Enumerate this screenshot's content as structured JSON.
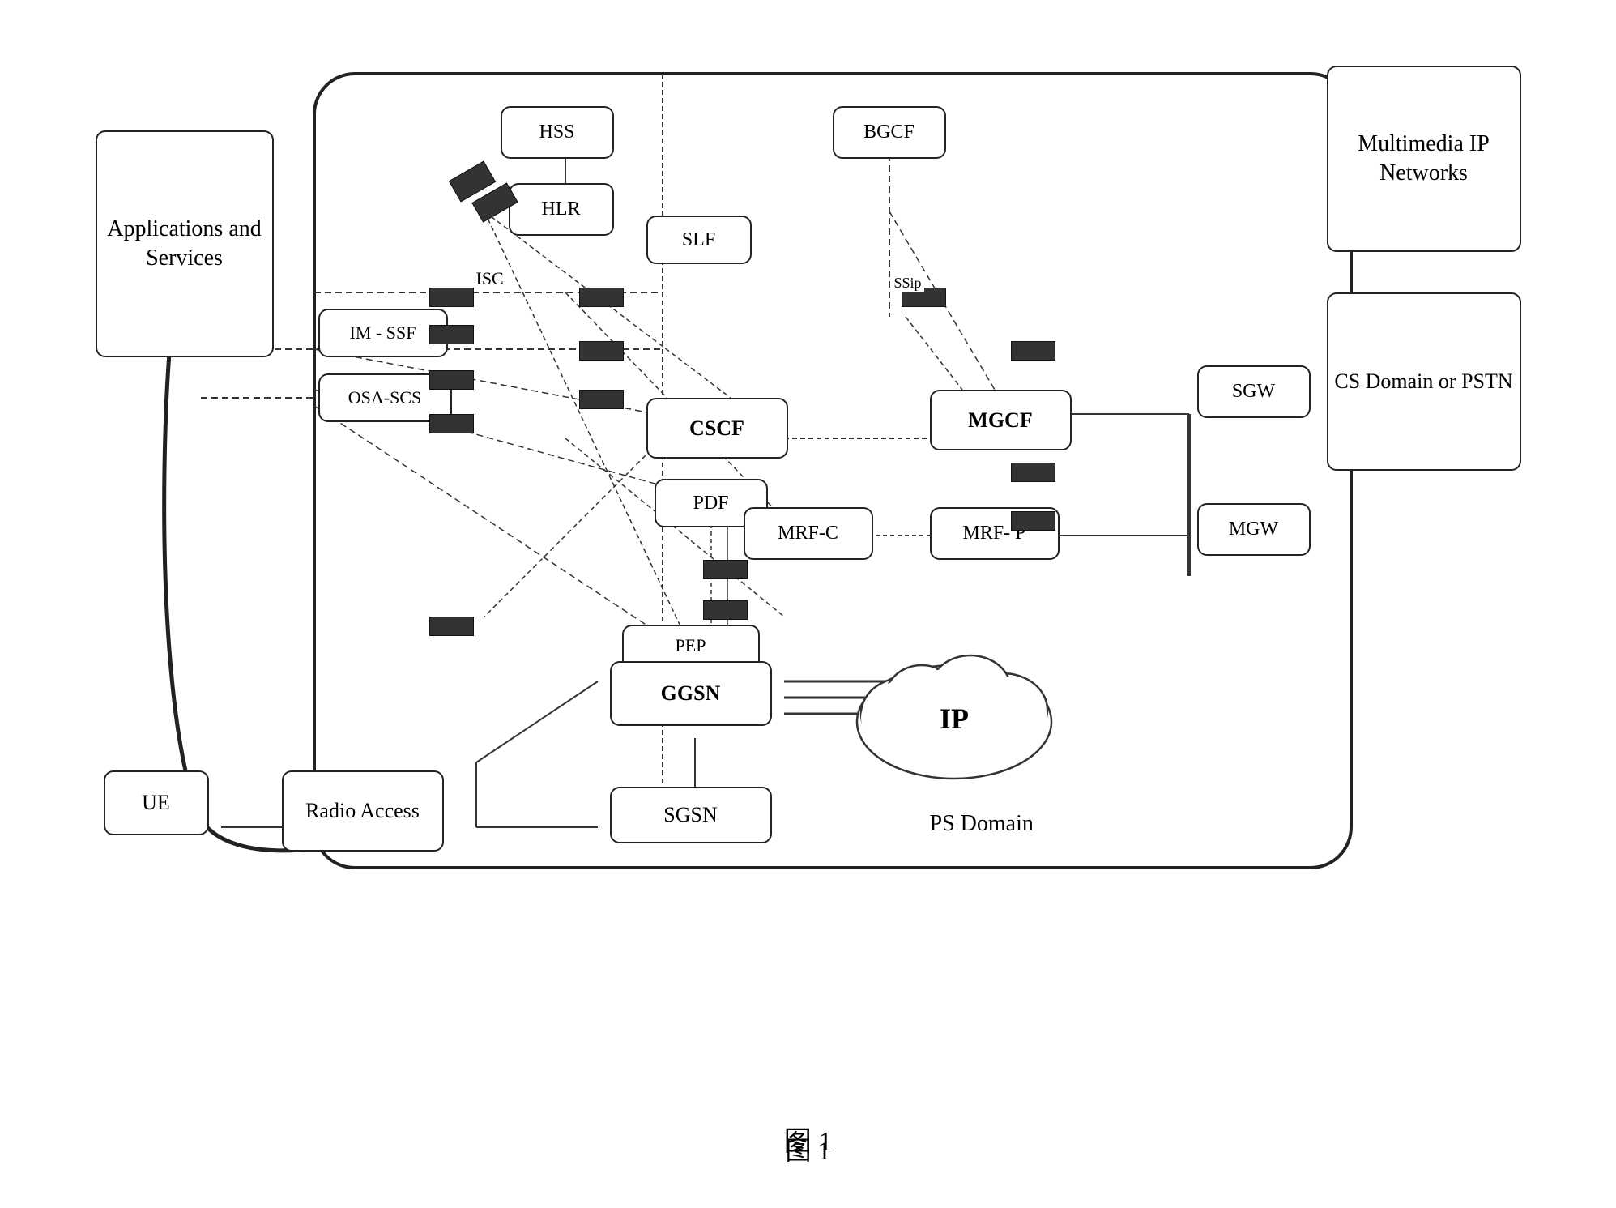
{
  "boxes": {
    "applications_services": "Applications\nand\nServices",
    "multimedia_ip_networks": "Multimedia\nIP\nNetworks",
    "cs_domain": "CS Domain\nor PSTN",
    "ue": "UE",
    "radio_access": "Radio\nAccess",
    "hss": "HSS",
    "hlr": "HLR",
    "slf": "SLF",
    "bgcf": "BGCF",
    "im_ssf": "IM - SSF",
    "osa_scs": "OSA-SCS",
    "cscf": "CSCF",
    "pdf": "PDF",
    "mgcf": "MGCF",
    "sgw": "SGW",
    "mgw": "MGW",
    "mrf_c": "MRF-C",
    "mrf_p": "MRF- P",
    "pep": "PEP",
    "ggsn": "GGSN",
    "sgsn": "SGSN",
    "ip": "IP"
  },
  "labels": {
    "ps_domain": "PS Domain",
    "isc": "ISC",
    "sip": "SSip"
  },
  "figure": {
    "caption": "图 1"
  }
}
